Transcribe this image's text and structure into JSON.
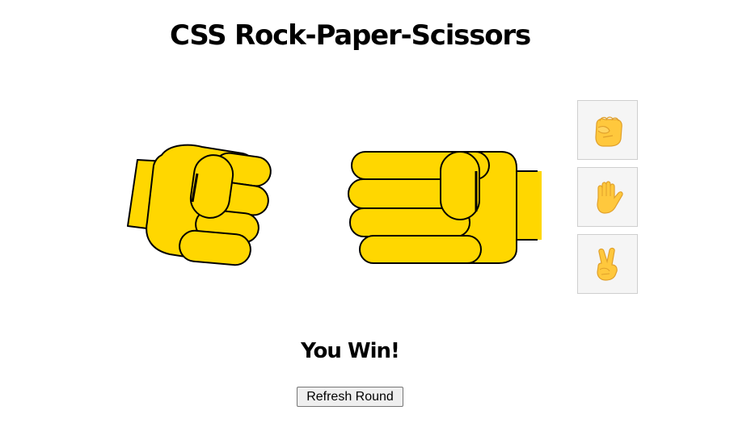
{
  "game": {
    "title": "CSS Rock-Paper-Scissors",
    "player_choice": "rock",
    "computer_choice": "rock",
    "result": "You Win!",
    "refresh_label": "Refresh Round"
  },
  "choices": [
    {
      "name": "rock",
      "icon": "raised-fist-icon"
    },
    {
      "name": "paper",
      "icon": "raised-hand-icon"
    },
    {
      "name": "scissors",
      "icon": "victory-hand-icon"
    }
  ],
  "colors": {
    "hand_fill": "#FFD700",
    "hand_stroke": "#000000",
    "emoji_fill": "#FFC83D",
    "emoji_shade": "#E0A02B",
    "button_bg": "#F5F5F5"
  }
}
